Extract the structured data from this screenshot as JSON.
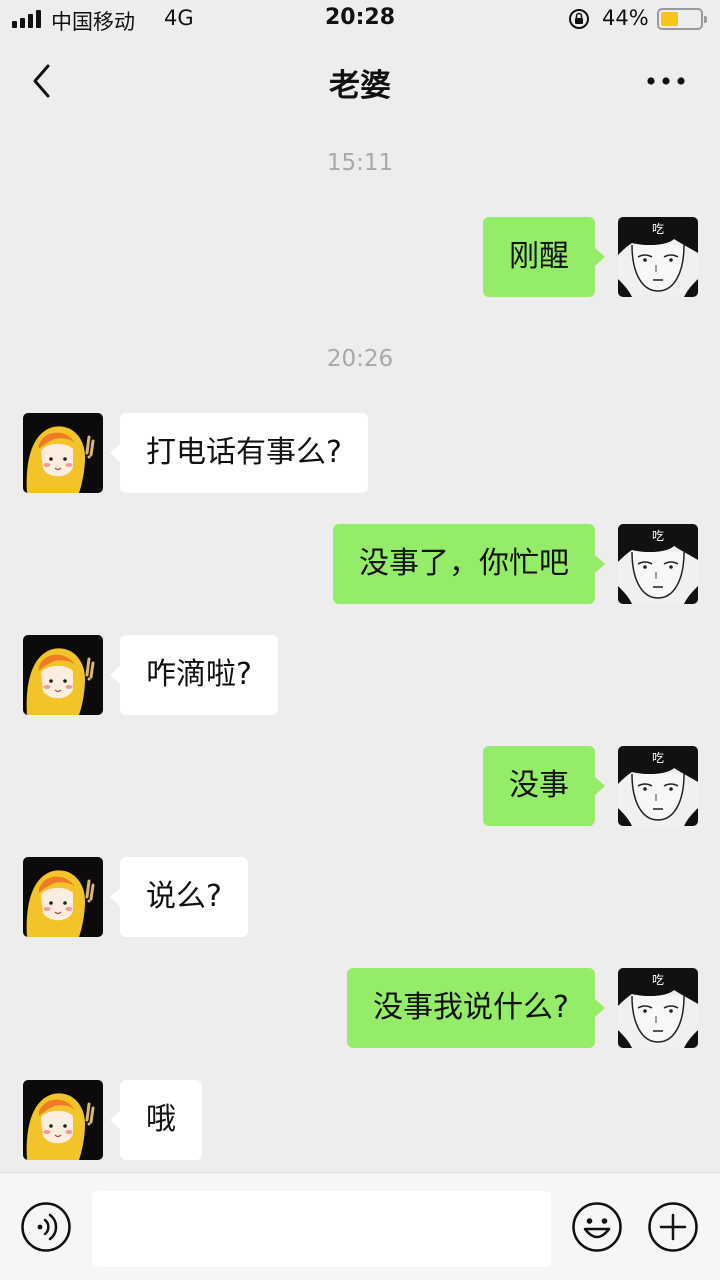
{
  "status_bar": {
    "carrier": "中国移动",
    "network": "4G",
    "time": "20:28",
    "battery_percent": "44%",
    "battery_level": 0.44,
    "battery_color": "#f5c518"
  },
  "navbar": {
    "title": "老婆",
    "back_icon": "chevron-left-icon",
    "more_icon": "more-dots-icon"
  },
  "messages": {
    "ts1": "15:11",
    "m1": "刚醒",
    "ts2": "20:26",
    "m2": "打电话有事么?",
    "m3": "没事了，你忙吧",
    "m4": "咋滴啦?",
    "m5": "没事",
    "m6": "说么?",
    "m7": "没事我说什么?",
    "m8": "哦"
  },
  "input_bar": {
    "value": "",
    "voice_icon": "voice-icon",
    "emoji_icon": "emoji-icon",
    "plus_icon": "plus-icon"
  },
  "colors": {
    "sent_bubble": "#95ec69",
    "received_bubble": "#ffffff",
    "background": "#ededed"
  }
}
